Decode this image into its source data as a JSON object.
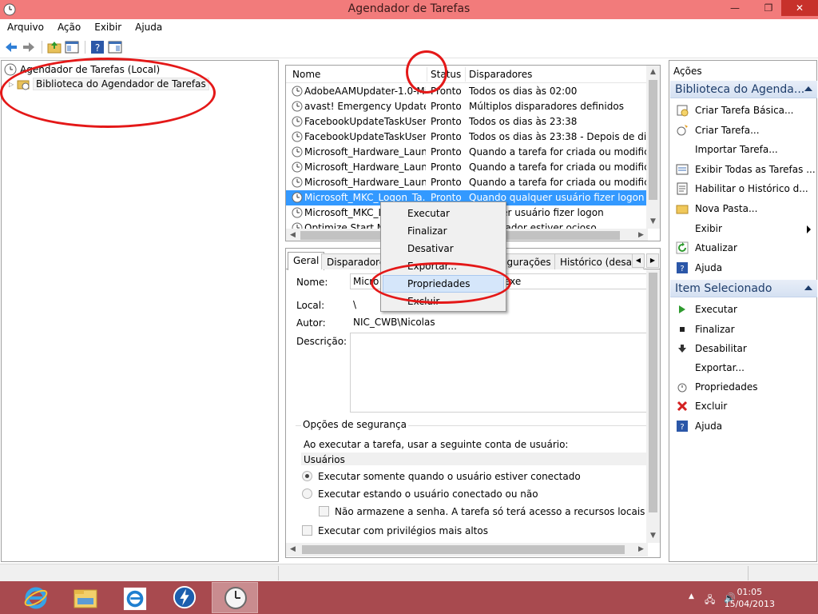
{
  "window": {
    "title": "Agendador de Tarefas",
    "minimize": "—",
    "maximize": "❐",
    "close": "✕"
  },
  "menu": [
    "Arquivo",
    "Ação",
    "Exibir",
    "Ajuda"
  ],
  "tree": {
    "root": "Agendador de Tarefas (Local)",
    "child": "Biblioteca do Agendador de Tarefas"
  },
  "task_list": {
    "columns": [
      "Nome",
      "Status",
      "Disparadores"
    ],
    "rows": [
      {
        "name": "AdobeAAMUpdater-1.0-Mi...",
        "status": "Pronto",
        "trigger": "Todos os dias às 02:00"
      },
      {
        "name": "avast! Emergency Update",
        "status": "Pronto",
        "trigger": "Múltiplos disparadores definidos"
      },
      {
        "name": "FacebookUpdateTaskUser...",
        "status": "Pronto",
        "trigger": "Todos os dias às 23:38"
      },
      {
        "name": "FacebookUpdateTaskUser...",
        "status": "Pronto",
        "trigger": "Todos os dias às 23:38 - Depois de dispara"
      },
      {
        "name": "Microsoft_Hardware_Laun...",
        "status": "Pronto",
        "trigger": "Quando a tarefa for criada ou modificada"
      },
      {
        "name": "Microsoft_Hardware_Laun...",
        "status": "Pronto",
        "trigger": "Quando a tarefa for criada ou modificada"
      },
      {
        "name": "Microsoft_Hardware_Laun...",
        "status": "Pronto",
        "trigger": "Quando a tarefa for criada ou modificada"
      },
      {
        "name": "Microsoft_MKC_Logon_Ta...",
        "status": "Pronto",
        "trigger": "Quando qualquer usuário fizer logon"
      },
      {
        "name": "Microsoft_MKC_L",
        "status": "",
        "trigger": "qualquer usuário fizer logon"
      },
      {
        "name": "Optimize Start M...",
        "status": "",
        "trigger": "computador estiver ocioso"
      }
    ],
    "selected_index": 7
  },
  "context_menu": {
    "items": [
      "Executar",
      "Finalizar",
      "Desativar",
      "Exportar...",
      "Propriedades",
      "Excluir"
    ],
    "hover_index": 4
  },
  "details": {
    "tabs": [
      "Geral",
      "Disparadores",
      "figurações",
      "Histórico (desab"
    ],
    "active_tab": 0,
    "labels": {
      "name": "Nome:",
      "location": "Local:",
      "author": "Autor:",
      "description": "Descrição:"
    },
    "name_value_left": "Micro",
    "name_value_right": "exe",
    "location_value": "\\",
    "author_value": "NIC_CWB\\Nicolas",
    "security": {
      "title": "Opções de segurança",
      "run_as_text": "Ao executar a tarefa, usar a seguinte conta de usuário:",
      "account": "Usuários",
      "options": [
        "Executar somente quando o usuário estiver conectado",
        "Executar estando o usuário conectado ou não",
        "Não armazene a senha. A tarefa só terá acesso a recursos locais",
        "Executar com privilégios mais altos"
      ]
    }
  },
  "actions": {
    "title": "Ações",
    "sections": [
      {
        "title": "Biblioteca do Agenda...",
        "items": [
          {
            "label": "Criar Tarefa Básica...",
            "icon": "create-basic-task-icon"
          },
          {
            "label": "Criar Tarefa...",
            "icon": "create-task-icon"
          },
          {
            "label": "Importar Tarefa...",
            "icon": ""
          },
          {
            "label": "Exibir Todas as Tarefas ...",
            "icon": "display-all-tasks-icon"
          },
          {
            "label": "Habilitar o Histórico d...",
            "icon": "enable-history-icon"
          },
          {
            "label": "Nova Pasta...",
            "icon": "folder-icon"
          },
          {
            "label": "Exibir",
            "icon": ""
          },
          {
            "label": "Atualizar",
            "icon": "refresh-icon"
          },
          {
            "label": "Ajuda",
            "icon": "help-icon"
          }
        ]
      },
      {
        "title": "Item Selecionado",
        "items": [
          {
            "label": "Executar",
            "icon": "run-icon"
          },
          {
            "label": "Finalizar",
            "icon": "stop-icon"
          },
          {
            "label": "Desabilitar",
            "icon": "disable-icon"
          },
          {
            "label": "Exportar...",
            "icon": ""
          },
          {
            "label": "Propriedades",
            "icon": "properties-icon"
          },
          {
            "label": "Excluir",
            "icon": "delete-icon"
          },
          {
            "label": "Ajuda",
            "icon": "help-icon"
          }
        ]
      }
    ]
  },
  "taskbar": {
    "time": "01:05",
    "date": "15/04/2013"
  },
  "colors": {
    "titlebar": "#f27b7b",
    "taskbar": "#a84a4f",
    "selection": "#3399ff",
    "annotation": "#e41818"
  }
}
